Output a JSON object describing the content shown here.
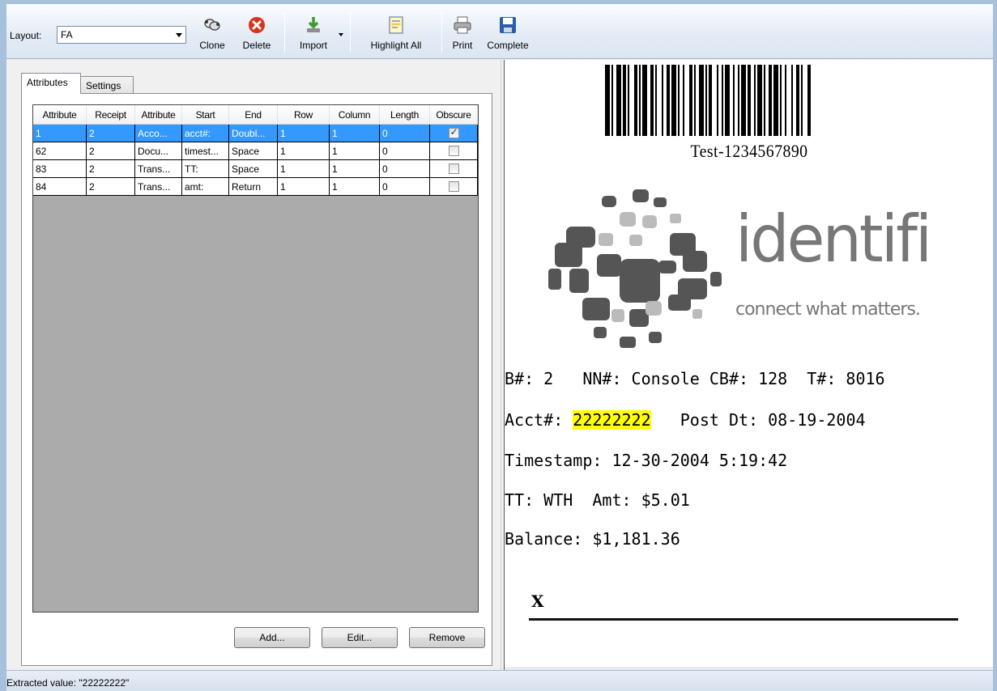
{
  "toolbar": {
    "layout_label": "Layout:",
    "layout_value": "FA",
    "buttons": {
      "clone": "Clone",
      "delete": "Delete",
      "import": "Import",
      "highlight_all": "Highlight All",
      "print": "Print",
      "complete": "Complete"
    }
  },
  "tabs": [
    "Attributes",
    "Settings"
  ],
  "grid": {
    "columns": [
      "Attribute",
      "Receipt",
      "Attribute",
      "Start",
      "End",
      "Row",
      "Column",
      "Length",
      "Obscure"
    ],
    "rows": [
      {
        "c0": "1",
        "c1": "2",
        "c2": "Acco...",
        "c3": "acct#:",
        "c4": "Doubl...",
        "c5": "1",
        "c6": "1",
        "c7": "0",
        "obscure": true
      },
      {
        "c0": "62",
        "c1": "2",
        "c2": "Docu...",
        "c3": "timest...",
        "c4": "Space",
        "c5": "1",
        "c6": "1",
        "c7": "0",
        "obscure": false
      },
      {
        "c0": "83",
        "c1": "2",
        "c2": "Trans...",
        "c3": "TT:",
        "c4": "Space",
        "c5": "1",
        "c6": "1",
        "c7": "0",
        "obscure": false
      },
      {
        "c0": "84",
        "c1": "2",
        "c2": "Trans...",
        "c3": "amt:",
        "c4": "Return",
        "c5": "1",
        "c6": "1",
        "c7": "0",
        "obscure": false
      }
    ]
  },
  "grid_buttons": {
    "add": "Add...",
    "edit": "Edit...",
    "remove": "Remove"
  },
  "receipt": {
    "barcode_text": "Test-1234567890",
    "logo_word": "identifi",
    "logo_tagline": "connect what matters.",
    "line1": "B#: 2   NN#: Console CB#: 128  T#: 8016",
    "acct_label": "Acct#: ",
    "acct_value": "22222222",
    "acct_rest": "   Post Dt: 08-19-2004",
    "line3": "Timestamp: 12-30-2004 5:19:42",
    "line4": "TT: WTH  Amt: $5.01",
    "line5": "Balance: $1,181.36",
    "sig_mark": "X"
  },
  "status": {
    "text": "Extracted value: \"22222222\""
  },
  "colors": {
    "selection": "#3399ff",
    "highlight": "#ffff00",
    "logo_gray": "#777777"
  }
}
